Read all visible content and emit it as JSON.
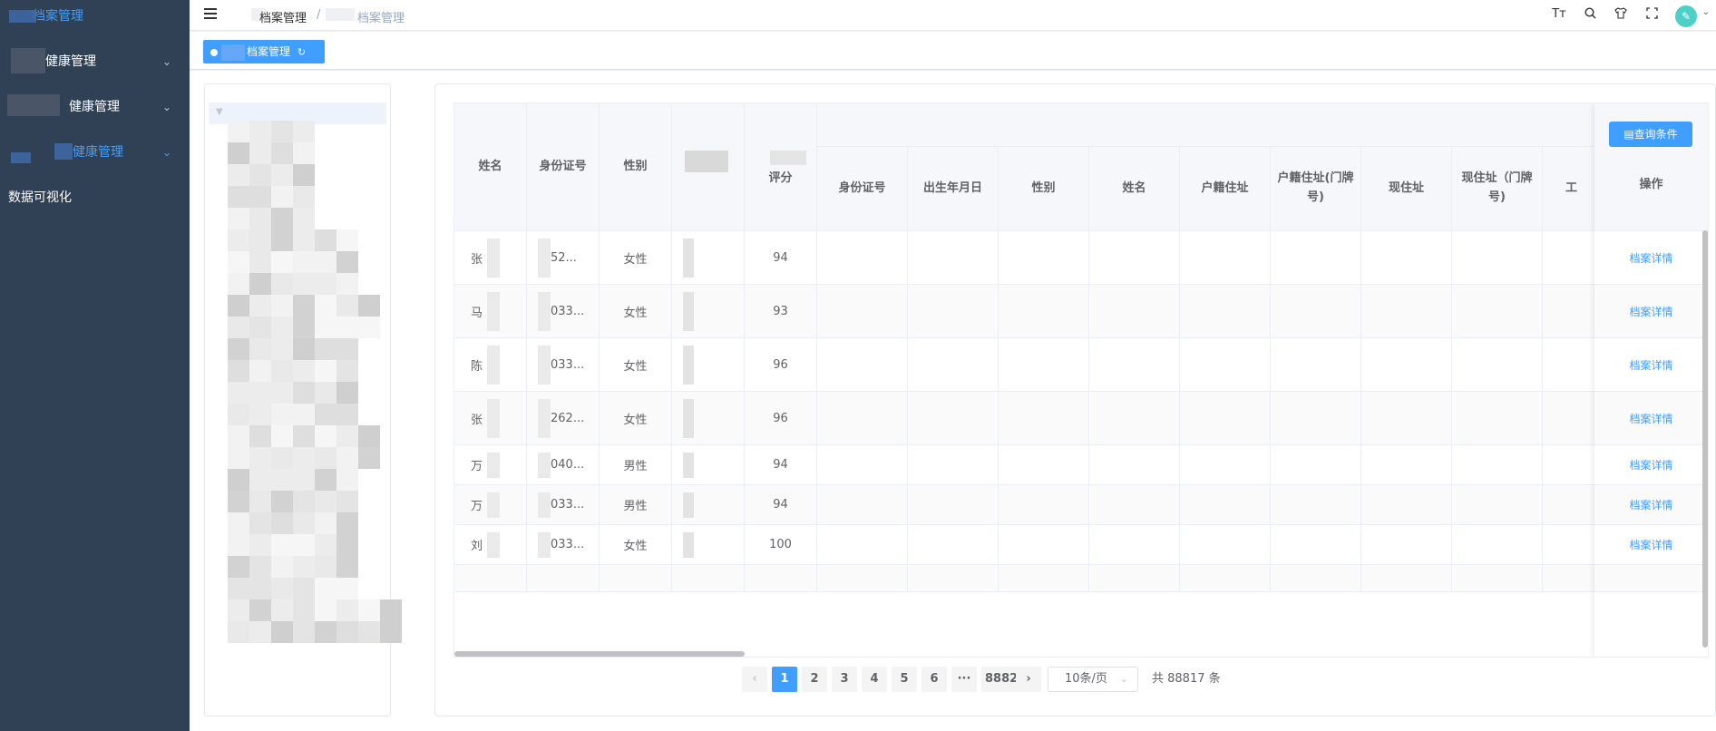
{
  "sidebar": {
    "logo_text": "档案管理",
    "items": [
      {
        "label": "健康管理"
      },
      {
        "label": "健康管理"
      },
      {
        "label": "健康管理"
      },
      {
        "label": "数据可视化"
      }
    ]
  },
  "header": {
    "breadcrumb": [
      "档案管理",
      "档案管理"
    ],
    "breadcrumb_sep": "/",
    "icons": [
      "text-size-icon",
      "search-icon",
      "theme-shirt-icon",
      "fullscreen-icon"
    ]
  },
  "tags": {
    "active_tag": "档案管理"
  },
  "table": {
    "left_headers": [
      "姓名",
      "身份证号",
      "性别",
      "",
      "评分"
    ],
    "right_headers": [
      "身份证号",
      "出生年月日",
      "性别",
      "姓名",
      "户籍住址",
      "户籍住址(门牌号)",
      "现住址",
      "现住址（门牌号)",
      "工"
    ],
    "action_header": "操作",
    "query_button": "查询条件",
    "rows": [
      {
        "name": "张",
        "id": "52...",
        "gender": "女性",
        "score": "94",
        "action": "档案详情"
      },
      {
        "name": "马",
        "id": "033...",
        "gender": "女性",
        "score": "93",
        "action": "档案详情"
      },
      {
        "name": "陈",
        "id": "033...",
        "gender": "女性",
        "score": "96",
        "action": "档案详情"
      },
      {
        "name": "张",
        "id": "262...",
        "gender": "女性",
        "score": "96",
        "action": "档案详情"
      },
      {
        "name": "万",
        "id": "040...",
        "gender": "男性",
        "score": "94",
        "action": "档案详情"
      },
      {
        "name": "万",
        "id": "033...",
        "gender": "男性",
        "score": "94",
        "action": "档案详情"
      },
      {
        "name": "刘",
        "id": "033...",
        "gender": "女性",
        "score": "100",
        "action": "档案详情"
      }
    ]
  },
  "pagination": {
    "pages": [
      "1",
      "2",
      "3",
      "4",
      "5",
      "6",
      "···",
      "8882"
    ],
    "current": "1",
    "page_size": "10条/页",
    "total": "共 88817 条"
  }
}
